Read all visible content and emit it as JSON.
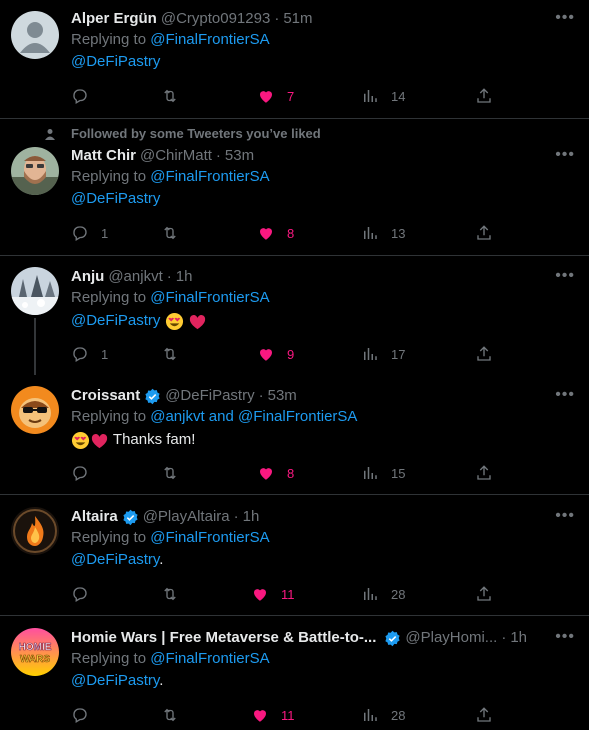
{
  "colors": {
    "background": "#000000",
    "text": "#e7e9ea",
    "muted": "#71767b",
    "link": "#1d9bf0",
    "like": "#f91880",
    "border": "#2f3336"
  },
  "tweets": [
    {
      "name": "Alper Ergün",
      "handle": "@Crypto091293",
      "time": "51m",
      "replying_prefix": "Replying to",
      "replying_to": "@FinalFrontierSA",
      "body_mention": "@DeFiPastry",
      "body_suffix": "",
      "reply_count": "",
      "retweet_count": "",
      "like_count": "7",
      "view_count": "14",
      "liked": true,
      "avatar": "default-avatar"
    },
    {
      "social_context": "Followed by some Tweeters you’ve liked",
      "name": "Matt Chir",
      "handle": "@ChirMatt",
      "time": "53m",
      "replying_prefix": "Replying to",
      "replying_to": "@FinalFrontierSA",
      "body_mention": "@DeFiPastry",
      "body_suffix": "",
      "reply_count": "1",
      "retweet_count": "",
      "like_count": "8",
      "view_count": "13",
      "liked": true,
      "avatar": "bearded-man-avatar"
    },
    {
      "name": "Anju",
      "handle": "@anjkvt",
      "time": "1h",
      "replying_prefix": "Replying to",
      "replying_to": "@FinalFrontierSA",
      "body_mention": "@DeFiPastry",
      "body_emojis": [
        "heart-eyes-emoji",
        "red-heart-emoji"
      ],
      "reply_count": "1",
      "retweet_count": "",
      "like_count": "9",
      "view_count": "17",
      "liked": true,
      "avatar": "snowy-landscape-avatar"
    },
    {
      "name": "Croissant",
      "handle": "@DeFiPastry",
      "time": "53m",
      "verified": true,
      "replying_prefix": "Replying to",
      "replying_to": "@anjkvt and @FinalFrontierSA",
      "body_emojis": [
        "heart-eyes-emoji",
        "red-heart-emoji"
      ],
      "body_text": "Thanks fam!",
      "reply_count": "",
      "retweet_count": "",
      "like_count": "8",
      "view_count": "15",
      "liked": true,
      "avatar": "croissant-sunglasses-avatar"
    },
    {
      "name": "Altaira",
      "handle": "@PlayAltaira",
      "time": "1h",
      "verified": true,
      "replying_prefix": "Replying to",
      "replying_to": "@FinalFrontierSA",
      "body_mention": "@DeFiPastry",
      "body_suffix": ".",
      "reply_count": "",
      "retweet_count": "",
      "like_count": "11",
      "view_count": "28",
      "liked": true,
      "avatar": "flame-logo-avatar"
    },
    {
      "name": "Homie Wars | Free Metaverse & Battle-to-...",
      "handle": "@PlayHomi...",
      "time": "1h",
      "verified": true,
      "replying_prefix": "Replying to",
      "replying_to": "@FinalFrontierSA",
      "body_mention": "@DeFiPastry",
      "body_suffix": ".",
      "reply_count": "",
      "retweet_count": "",
      "like_count": "11",
      "view_count": "28",
      "liked": true,
      "avatar": "homie-wars-logo-avatar",
      "avatar_text": "HOMIE WARS"
    }
  ]
}
